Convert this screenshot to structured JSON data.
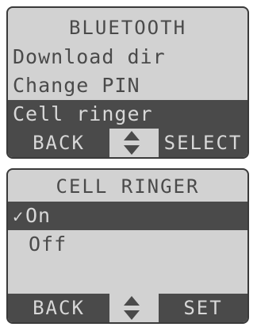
{
  "colors": {
    "screen_bg": "#d2d2d2",
    "ink": "#4a4a4a",
    "inverse_text": "#d8d8d8"
  },
  "bluetooth_menu": {
    "title": "BLUETOOTH",
    "items": [
      {
        "label": "Download dir",
        "selected": false
      },
      {
        "label": "Change PIN",
        "selected": false
      },
      {
        "label": "Cell ringer",
        "selected": true
      }
    ],
    "softkeys": {
      "left": "BACK",
      "right": "SELECT"
    },
    "nav_icon": "up-down-arrows-icon"
  },
  "cell_ringer_menu": {
    "title": "CELL RINGER",
    "options": [
      {
        "label": "On",
        "checked": true,
        "check_mark": "✓"
      },
      {
        "label": "Off",
        "checked": false,
        "check_mark": ""
      }
    ],
    "softkeys": {
      "left": "BACK",
      "right": "SET"
    },
    "nav_icon": "up-down-arrows-icon"
  }
}
